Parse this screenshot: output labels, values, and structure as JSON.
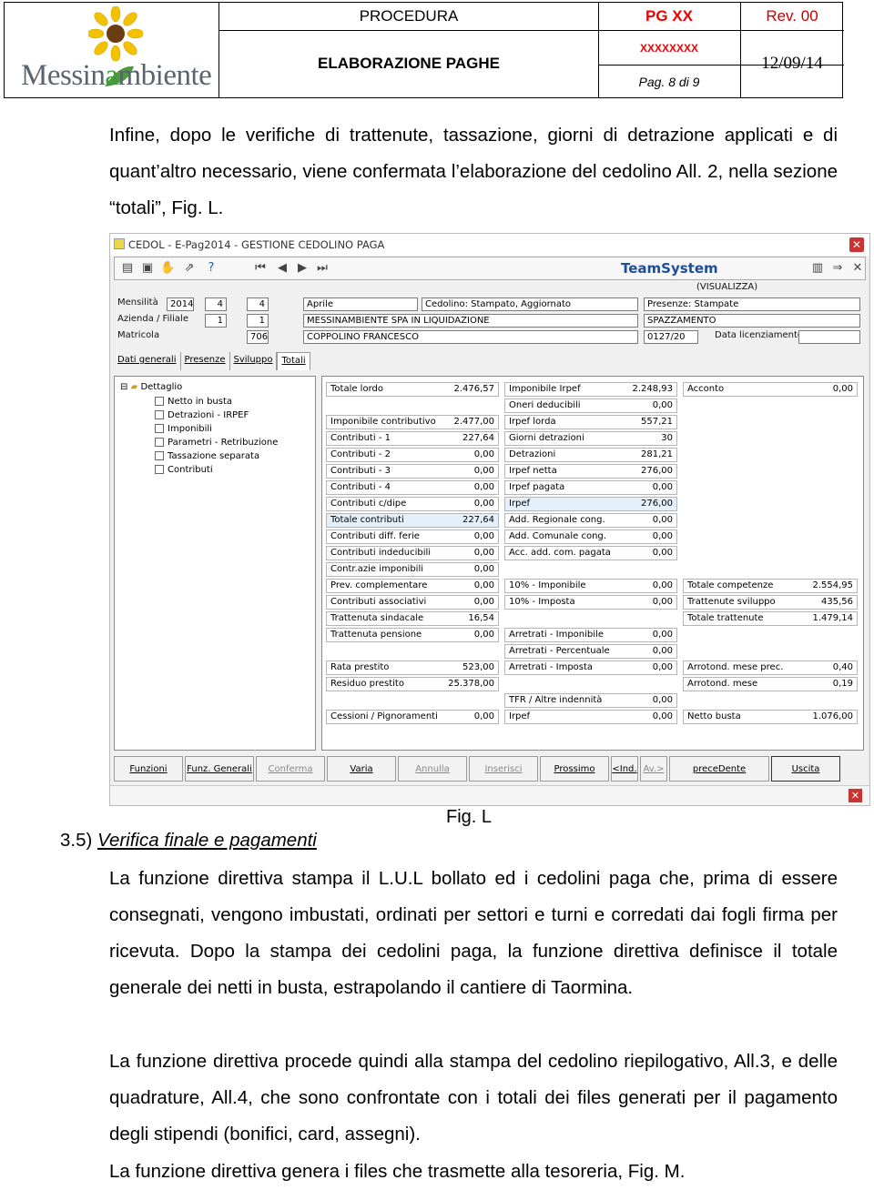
{
  "header": {
    "logo_text_pre": "Messin",
    "logo_text_a": "a",
    "logo_text_post": "mbiente",
    "procedura": "PROCEDURA",
    "pg": "PG XX",
    "rev": "Rev. 00",
    "title": "ELABORAZIONE PAGHE",
    "code": "XXXXXXXX",
    "page": "Pag. 8 di 9",
    "date": "12/09/14"
  },
  "intro": "Infine, dopo le verifiche di trattenute, tassazione, giorni di detrazione applicati e di quant’altro necessario, viene confermata l’elaborazione del cedolino All. 2, nella sezione “totali”, Fig. L.",
  "screenshot": {
    "title": "CEDOL - E-Pag2014 - GESTIONE CEDOLINO PAGA",
    "brand": "TeamSystem",
    "mode": "(VISUALIZZA)",
    "labels": {
      "mensilita": "Mensilità",
      "azienda": "Azienda / Filiale",
      "matricola": "Matricola",
      "data_lic": "Data licenziamento"
    },
    "fields": {
      "year": "2014",
      "m1": "4",
      "m2": "4",
      "az1": "1",
      "az2": "1",
      "matr": "706",
      "mese": "Aprile",
      "cedolino": "Cedolino: Stampato, Aggiornato",
      "presenze": "Presenze: Stampate",
      "azienda": "MESSINAMBIENTE SPA IN LIQUIDAZIONE",
      "cantiere": "SPAZZAMENTO",
      "nome": "COPPOLINO FRANCESCO",
      "codice": "0127/20"
    },
    "tabs": [
      "Dati generali",
      "Presenze",
      "Sviluppo",
      "Totali"
    ],
    "tree_root": "Dettaglio",
    "tree_items": [
      "Netto in busta",
      "Detrazioni - IRPEF",
      "Imponibili",
      "Parametri - Retribuzione",
      "Tassazione separata",
      "Contributi"
    ],
    "col1": [
      {
        "k": "Totale lordo",
        "v": "2.476,57"
      },
      {
        "k": "Imponibile contributivo",
        "v": "2.477,00"
      },
      {
        "k": "Contributi - 1",
        "v": "227,64"
      },
      {
        "k": "Contributi - 2",
        "v": "0,00"
      },
      {
        "k": "Contributi - 3",
        "v": "0,00"
      },
      {
        "k": "Contributi - 4",
        "v": "0,00"
      },
      {
        "k": "Contributi c/dipe",
        "v": "0,00"
      },
      {
        "k": "Totale contributi",
        "v": "227,64"
      },
      {
        "k": "Contributi diff. ferie",
        "v": "0,00"
      },
      {
        "k": "Contributi indeducibili",
        "v": "0,00"
      },
      {
        "k": "Contr.azie imponibili",
        "v": "0,00"
      },
      {
        "k": "Prev. complementare",
        "v": "0,00"
      },
      {
        "k": "Contributi associativi",
        "v": "0,00"
      },
      {
        "k": "Trattenuta sindacale",
        "v": "16,54"
      },
      {
        "k": "Trattenuta pensione",
        "v": "0,00"
      },
      {
        "k": "Rata prestito",
        "v": "523,00"
      },
      {
        "k": "Residuo prestito",
        "v": "25.378,00"
      },
      {
        "k": "Cessioni / Pignoramenti",
        "v": "0,00"
      }
    ],
    "col2": [
      {
        "k": "Imponibile Irpef",
        "v": "2.248,93"
      },
      {
        "k": "Oneri deducibili",
        "v": "0,00"
      },
      {
        "k": "Irpef lorda",
        "v": "557,21"
      },
      {
        "k": "Giorni detrazioni",
        "v": "30"
      },
      {
        "k": "Detrazioni",
        "v": "281,21"
      },
      {
        "k": "Irpef netta",
        "v": "276,00"
      },
      {
        "k": "Irpef pagata",
        "v": "0,00"
      },
      {
        "k": "Irpef",
        "v": "276,00"
      },
      {
        "k": "Add. Regionale cong.",
        "v": "0,00"
      },
      {
        "k": "Add. Comunale cong.",
        "v": "0,00"
      },
      {
        "k": "Acc. add. com. pagata",
        "v": "0,00"
      },
      {
        "k": "10% - Imponibile",
        "v": "0,00"
      },
      {
        "k": "10% - Imposta",
        "v": "0,00"
      },
      {
        "k": "Arretrati - Imponibile",
        "v": "0,00"
      },
      {
        "k": "Arretrati - Percentuale",
        "v": "0,00"
      },
      {
        "k": "Arretrati - Imposta",
        "v": "0,00"
      },
      {
        "k": "TFR / Altre indennità",
        "v": "0,00"
      },
      {
        "k": "Irpef",
        "v": "0,00"
      }
    ],
    "col3": [
      {
        "k": "Acconto",
        "v": "0,00"
      },
      {
        "k": "Totale competenze",
        "v": "2.554,95"
      },
      {
        "k": "Trattenute sviluppo",
        "v": "435,56"
      },
      {
        "k": "Totale trattenute",
        "v": "1.479,14"
      },
      {
        "k": "Arrotond. mese prec.",
        "v": "0,40"
      },
      {
        "k": "Arrotond. mese",
        "v": "0,19"
      },
      {
        "k": "Netto busta",
        "v": "1.076,00"
      }
    ],
    "buttons": [
      "Funzioni",
      "Funz. Generali",
      "Conferma",
      "Varia",
      "Annulla",
      "Inserisci",
      "Prossimo",
      "<Ind.",
      "Av.>",
      "preceDente",
      "Uscita"
    ]
  },
  "caption": "Fig. L",
  "section_num": "3.5)",
  "section_title": "Verifica finale e pagamenti",
  "p1": "La funzione direttiva stampa il L.U.L bollato ed i cedolini paga che, prima di essere consegnati, vengono imbustati, ordinati per settori e turni e corredati dai fogli firma per ricevuta. Dopo la stampa dei cedolini paga, la funzione direttiva definisce il totale generale dei netti in busta, estrapolando il cantiere di Taormina.",
  "p2": "La funzione direttiva procede  quindi alla stampa del cedolino riepilogativo, All.3,  e delle quadrature, All.4, che sono confrontate con i totali dei files generati per il pagamento degli stipendi (bonifici, card, assegni).",
  "p3": "La funzione direttiva genera i files che trasmette alla tesoreria, Fig. M."
}
